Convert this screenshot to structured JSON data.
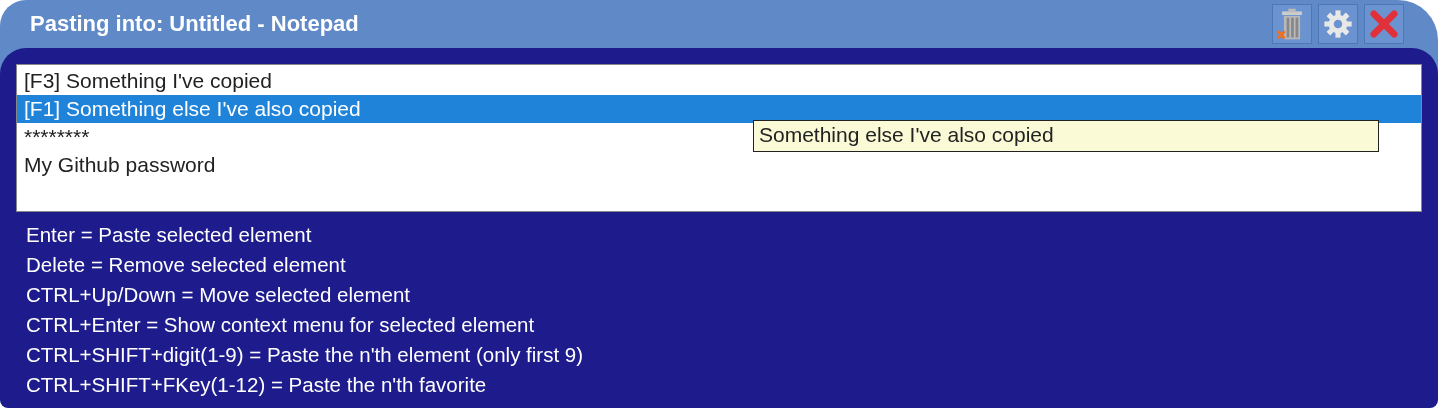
{
  "window": {
    "title": "Pasting into: Untitled - Notepad"
  },
  "toolbar": [
    {
      "kind": "clear"
    },
    {
      "kind": "settings"
    },
    {
      "kind": "close"
    }
  ],
  "items": [
    {
      "text": "[F3] Something I've copied",
      "selected": false
    },
    {
      "text": "[F1] Something else I've also copied",
      "selected": true
    },
    {
      "text": "********",
      "selected": false
    },
    {
      "text": "My Github password",
      "selected": false
    }
  ],
  "tooltip": {
    "text": "Something else I've also copied"
  },
  "help": [
    "Enter = Paste selected element",
    "Delete = Remove selected element",
    "CTRL+Up/Down = Move selected element",
    "CTRL+Enter = Show context menu for selected element",
    "CTRL+SHIFT+digit(1-9) = Paste the n'th element (only first 9)",
    "CTRL+SHIFT+FKey(1-12) = Paste the n'th favorite"
  ]
}
